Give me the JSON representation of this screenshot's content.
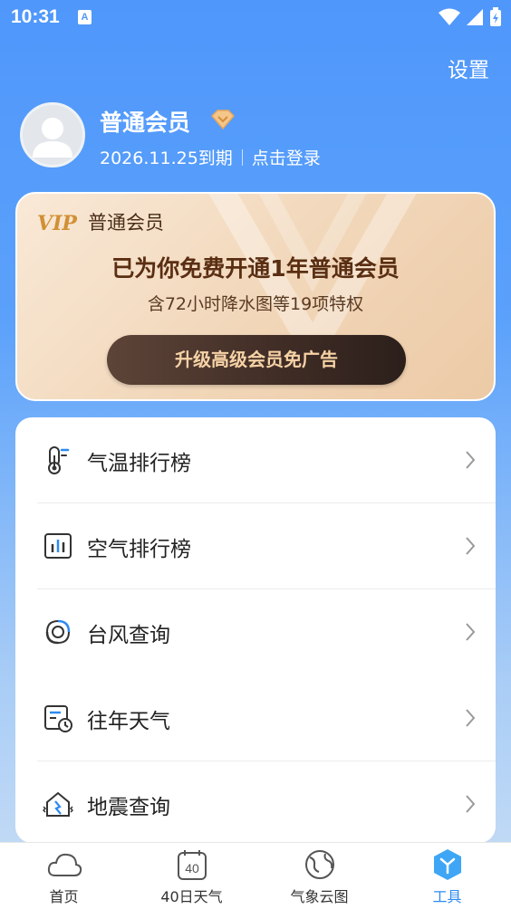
{
  "status_bar": {
    "time": "10:31",
    "notification_letter": "A"
  },
  "header": {
    "settings_label": "设置"
  },
  "profile": {
    "name": "普通会员",
    "expiry": "2026.11.25到期",
    "login_link": "点击登录"
  },
  "vip_card": {
    "logo": "VIP",
    "label": "普通会员",
    "headline": "已为你免费开通1年普通会员",
    "subtitle": "含72小时降水图等19项特权",
    "upgrade_button": "升级高级会员免广告"
  },
  "menu": {
    "items": [
      {
        "label": "气温排行榜",
        "icon": "thermometer-icon"
      },
      {
        "label": "空气排行榜",
        "icon": "bar-chart-icon"
      },
      {
        "label": "台风查询",
        "icon": "typhoon-icon"
      },
      {
        "label": "往年天气",
        "icon": "history-calendar-icon"
      },
      {
        "label": "地震查询",
        "icon": "earthquake-house-icon"
      }
    ]
  },
  "tab_bar": {
    "tabs": [
      {
        "label": "首页",
        "icon": "cloud-icon"
      },
      {
        "label": "40日天气",
        "icon": "calendar-40-icon",
        "icon_text": "40"
      },
      {
        "label": "气象云图",
        "icon": "globe-icon"
      },
      {
        "label": "工具",
        "icon": "tools-hex-icon",
        "active": true
      }
    ]
  },
  "colors": {
    "accent": "#2d8af0",
    "header_blue": "#4f97fb",
    "vip_gold": "#d19035",
    "vip_button": "#3f2c25"
  }
}
